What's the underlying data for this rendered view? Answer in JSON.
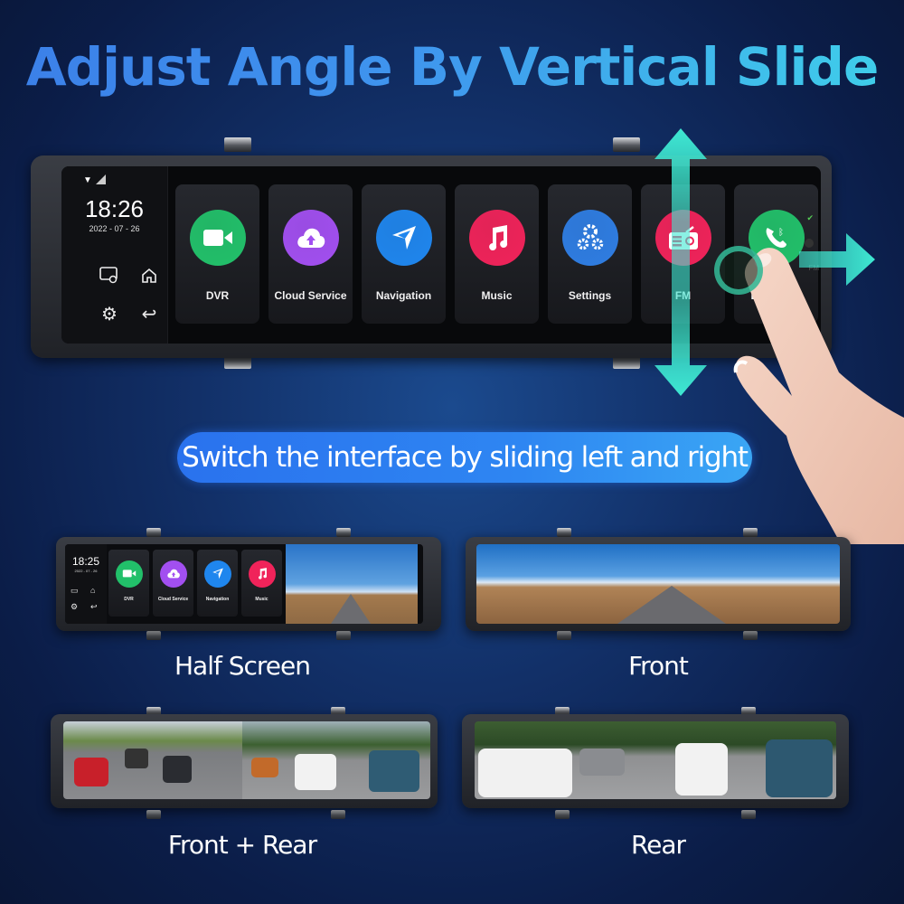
{
  "headline": "Adjust Angle By Vertical Slide",
  "banner": "Switch the interface by sliding left and right",
  "main_screen": {
    "time": "18:26",
    "date": "2022 - 07 - 26",
    "status_icons": [
      "wifi-icon",
      "signal-icon"
    ],
    "side_icons": [
      "screen-cast-icon",
      "home-icon",
      "gear-icon",
      "back-icon"
    ],
    "apps": [
      {
        "label": "DVR",
        "icon": "video-camera-icon",
        "color": "#22c06a"
      },
      {
        "label": "Cloud Service",
        "icon": "cloud-upload-icon",
        "color": "#a24ff0"
      },
      {
        "label": "Navigation",
        "icon": "navigation-arrow-icon",
        "color": "#1f86ee"
      },
      {
        "label": "Music",
        "icon": "music-note-icon",
        "color": "#f0235a"
      },
      {
        "label": "Settings",
        "icon": "gears-icon",
        "color": "#2f7de2"
      },
      {
        "label": "FM",
        "icon": "radio-icon",
        "color": "#f0235a"
      },
      {
        "label": "Bluetooth",
        "icon": "bluetooth-phone-icon",
        "color": "#22c06a"
      }
    ],
    "side_label": "FM"
  },
  "half_screen": {
    "time": "18:25",
    "date": "2022 - 07 - 26",
    "apps": [
      {
        "label": "DVR",
        "color": "#22c06a"
      },
      {
        "label": "Cloud Service",
        "color": "#a24ff0"
      },
      {
        "label": "Navigation",
        "color": "#1f86ee"
      },
      {
        "label": "Music",
        "color": "#f0235a"
      }
    ]
  },
  "modes": [
    {
      "label": "Half Screen"
    },
    {
      "label": "Front"
    },
    {
      "label": "Front + Rear"
    },
    {
      "label": "Rear"
    }
  ],
  "colors": {
    "accent_arrow": "#3ee8d2",
    "title_start": "#3b7fe8",
    "title_end": "#3fd0ea"
  }
}
